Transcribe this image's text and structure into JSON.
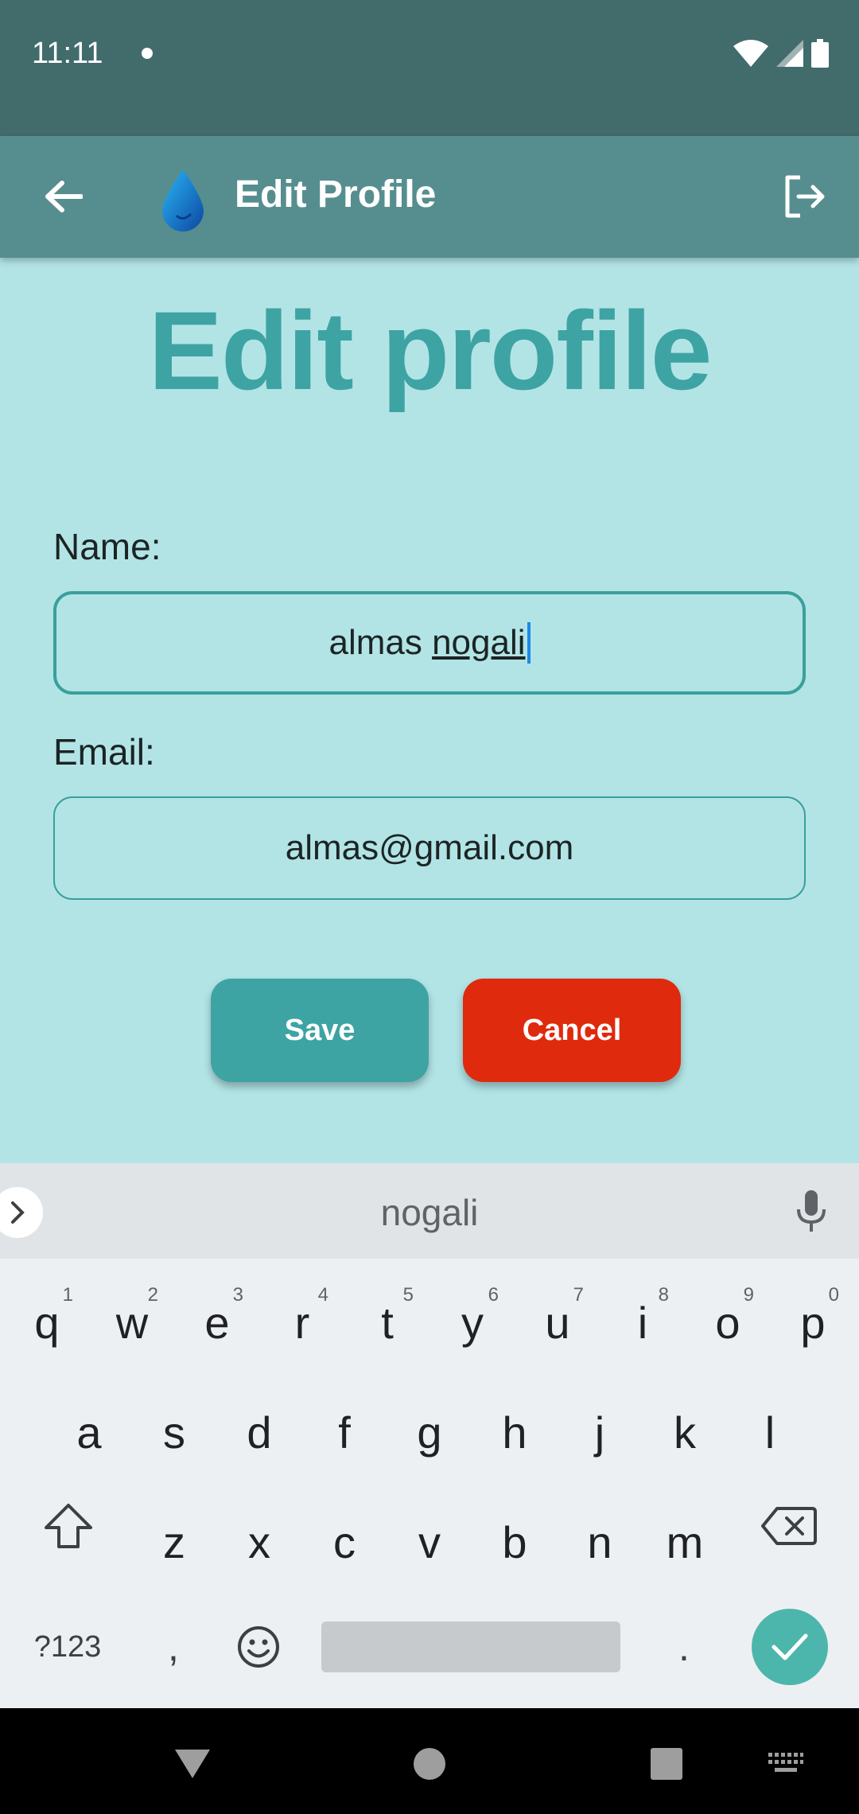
{
  "status_bar": {
    "time": "11:11"
  },
  "app_bar": {
    "title": "Edit Profile"
  },
  "page": {
    "heading": "Edit profile"
  },
  "form": {
    "name_label": "Name:",
    "name_value_first": "almas ",
    "name_value_second": "nogali",
    "email_label": "Email:",
    "email_value": "almas@gmail.com"
  },
  "buttons": {
    "save": "Save",
    "cancel": "Cancel"
  },
  "keyboard": {
    "suggestion": "nogali",
    "row1": [
      {
        "k": "q",
        "h": "1"
      },
      {
        "k": "w",
        "h": "2"
      },
      {
        "k": "e",
        "h": "3"
      },
      {
        "k": "r",
        "h": "4"
      },
      {
        "k": "t",
        "h": "5"
      },
      {
        "k": "y",
        "h": "6"
      },
      {
        "k": "u",
        "h": "7"
      },
      {
        "k": "i",
        "h": "8"
      },
      {
        "k": "o",
        "h": "9"
      },
      {
        "k": "p",
        "h": "0"
      }
    ],
    "row2": [
      "a",
      "s",
      "d",
      "f",
      "g",
      "h",
      "j",
      "k",
      "l"
    ],
    "row3": [
      "z",
      "x",
      "c",
      "v",
      "b",
      "n",
      "m"
    ],
    "symbols_label": "?123",
    "comma": ",",
    "period": "."
  },
  "colors": {
    "primary": "#3ea3a3",
    "cancel": "#e02a0d",
    "app_bar": "#568e8f",
    "status_bar": "#426b6c",
    "background": "#b2e4e6"
  }
}
